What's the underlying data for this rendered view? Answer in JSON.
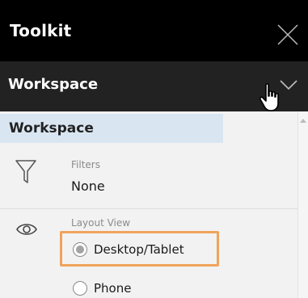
{
  "toolkit": {
    "title": "Toolkit",
    "close_icon": "close-icon"
  },
  "workspace_bar": {
    "label": "Workspace",
    "chevron_icon": "chevron-down-icon",
    "cursor_icon": "hand-pointer-icon"
  },
  "section": {
    "header": "Workspace"
  },
  "filters": {
    "icon": "filter-icon",
    "label": "Filters",
    "value": "None"
  },
  "layout_view": {
    "icon": "eye-icon",
    "label": "Layout View",
    "options": [
      {
        "label": "Desktop/Tablet",
        "selected": true
      },
      {
        "label": "Phone",
        "selected": false
      }
    ]
  },
  "colors": {
    "titlebar": "#000000",
    "workspace_bar": "#222222",
    "section_header": "#d9e6f2",
    "highlight": "#f0a35b"
  }
}
